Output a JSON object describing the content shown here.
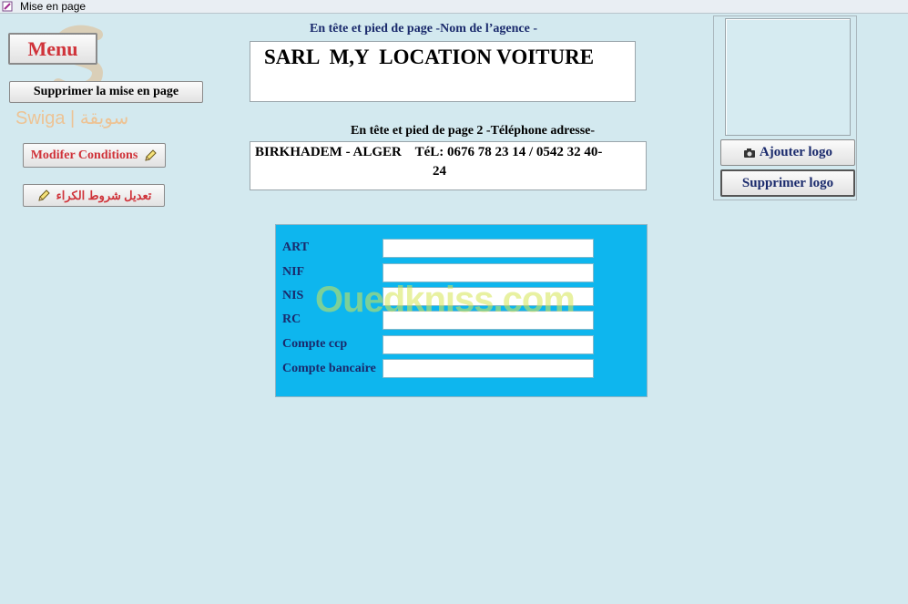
{
  "window": {
    "title": "Mise en page"
  },
  "left": {
    "menu_label": "Menu",
    "suppr_mise_label": "Supprimer la mise en page",
    "modifier_label": "Modifer Conditions",
    "tadil_label": "تعديل شروط الكراء"
  },
  "header": {
    "heading1": "En tête et pied de page  -Nom de l’agence -",
    "agency_name": "SARL  M,Y  LOCATION VOITURE",
    "heading2": "En tête et pied de page 2 -Téléphone adresse-",
    "address_line1": "BIRKHADEM - ALGER    TéL: 0676 78 23 14 / 0542 32 40-",
    "address_line2": "24"
  },
  "logo": {
    "add_label": "Ajouter logo",
    "remove_label": "Supprimer logo"
  },
  "info": {
    "fields": [
      {
        "label": "ART",
        "value": ""
      },
      {
        "label": "NIF",
        "value": ""
      },
      {
        "label": "NIS",
        "value": ""
      },
      {
        "label": "RC",
        "value": ""
      },
      {
        "label": "Compte ccp",
        "value": ""
      },
      {
        "label": "Compte bancaire",
        "value": ""
      }
    ]
  },
  "watermarks": {
    "swiga": "Swiga | سويقة",
    "ouedkniss": "Ouedkniss.com"
  },
  "colors": {
    "background": "#d3e9ef",
    "info_panel": "#0eb6ee",
    "accent_red": "#d0333a",
    "label_blue": "#1a2a6c"
  }
}
